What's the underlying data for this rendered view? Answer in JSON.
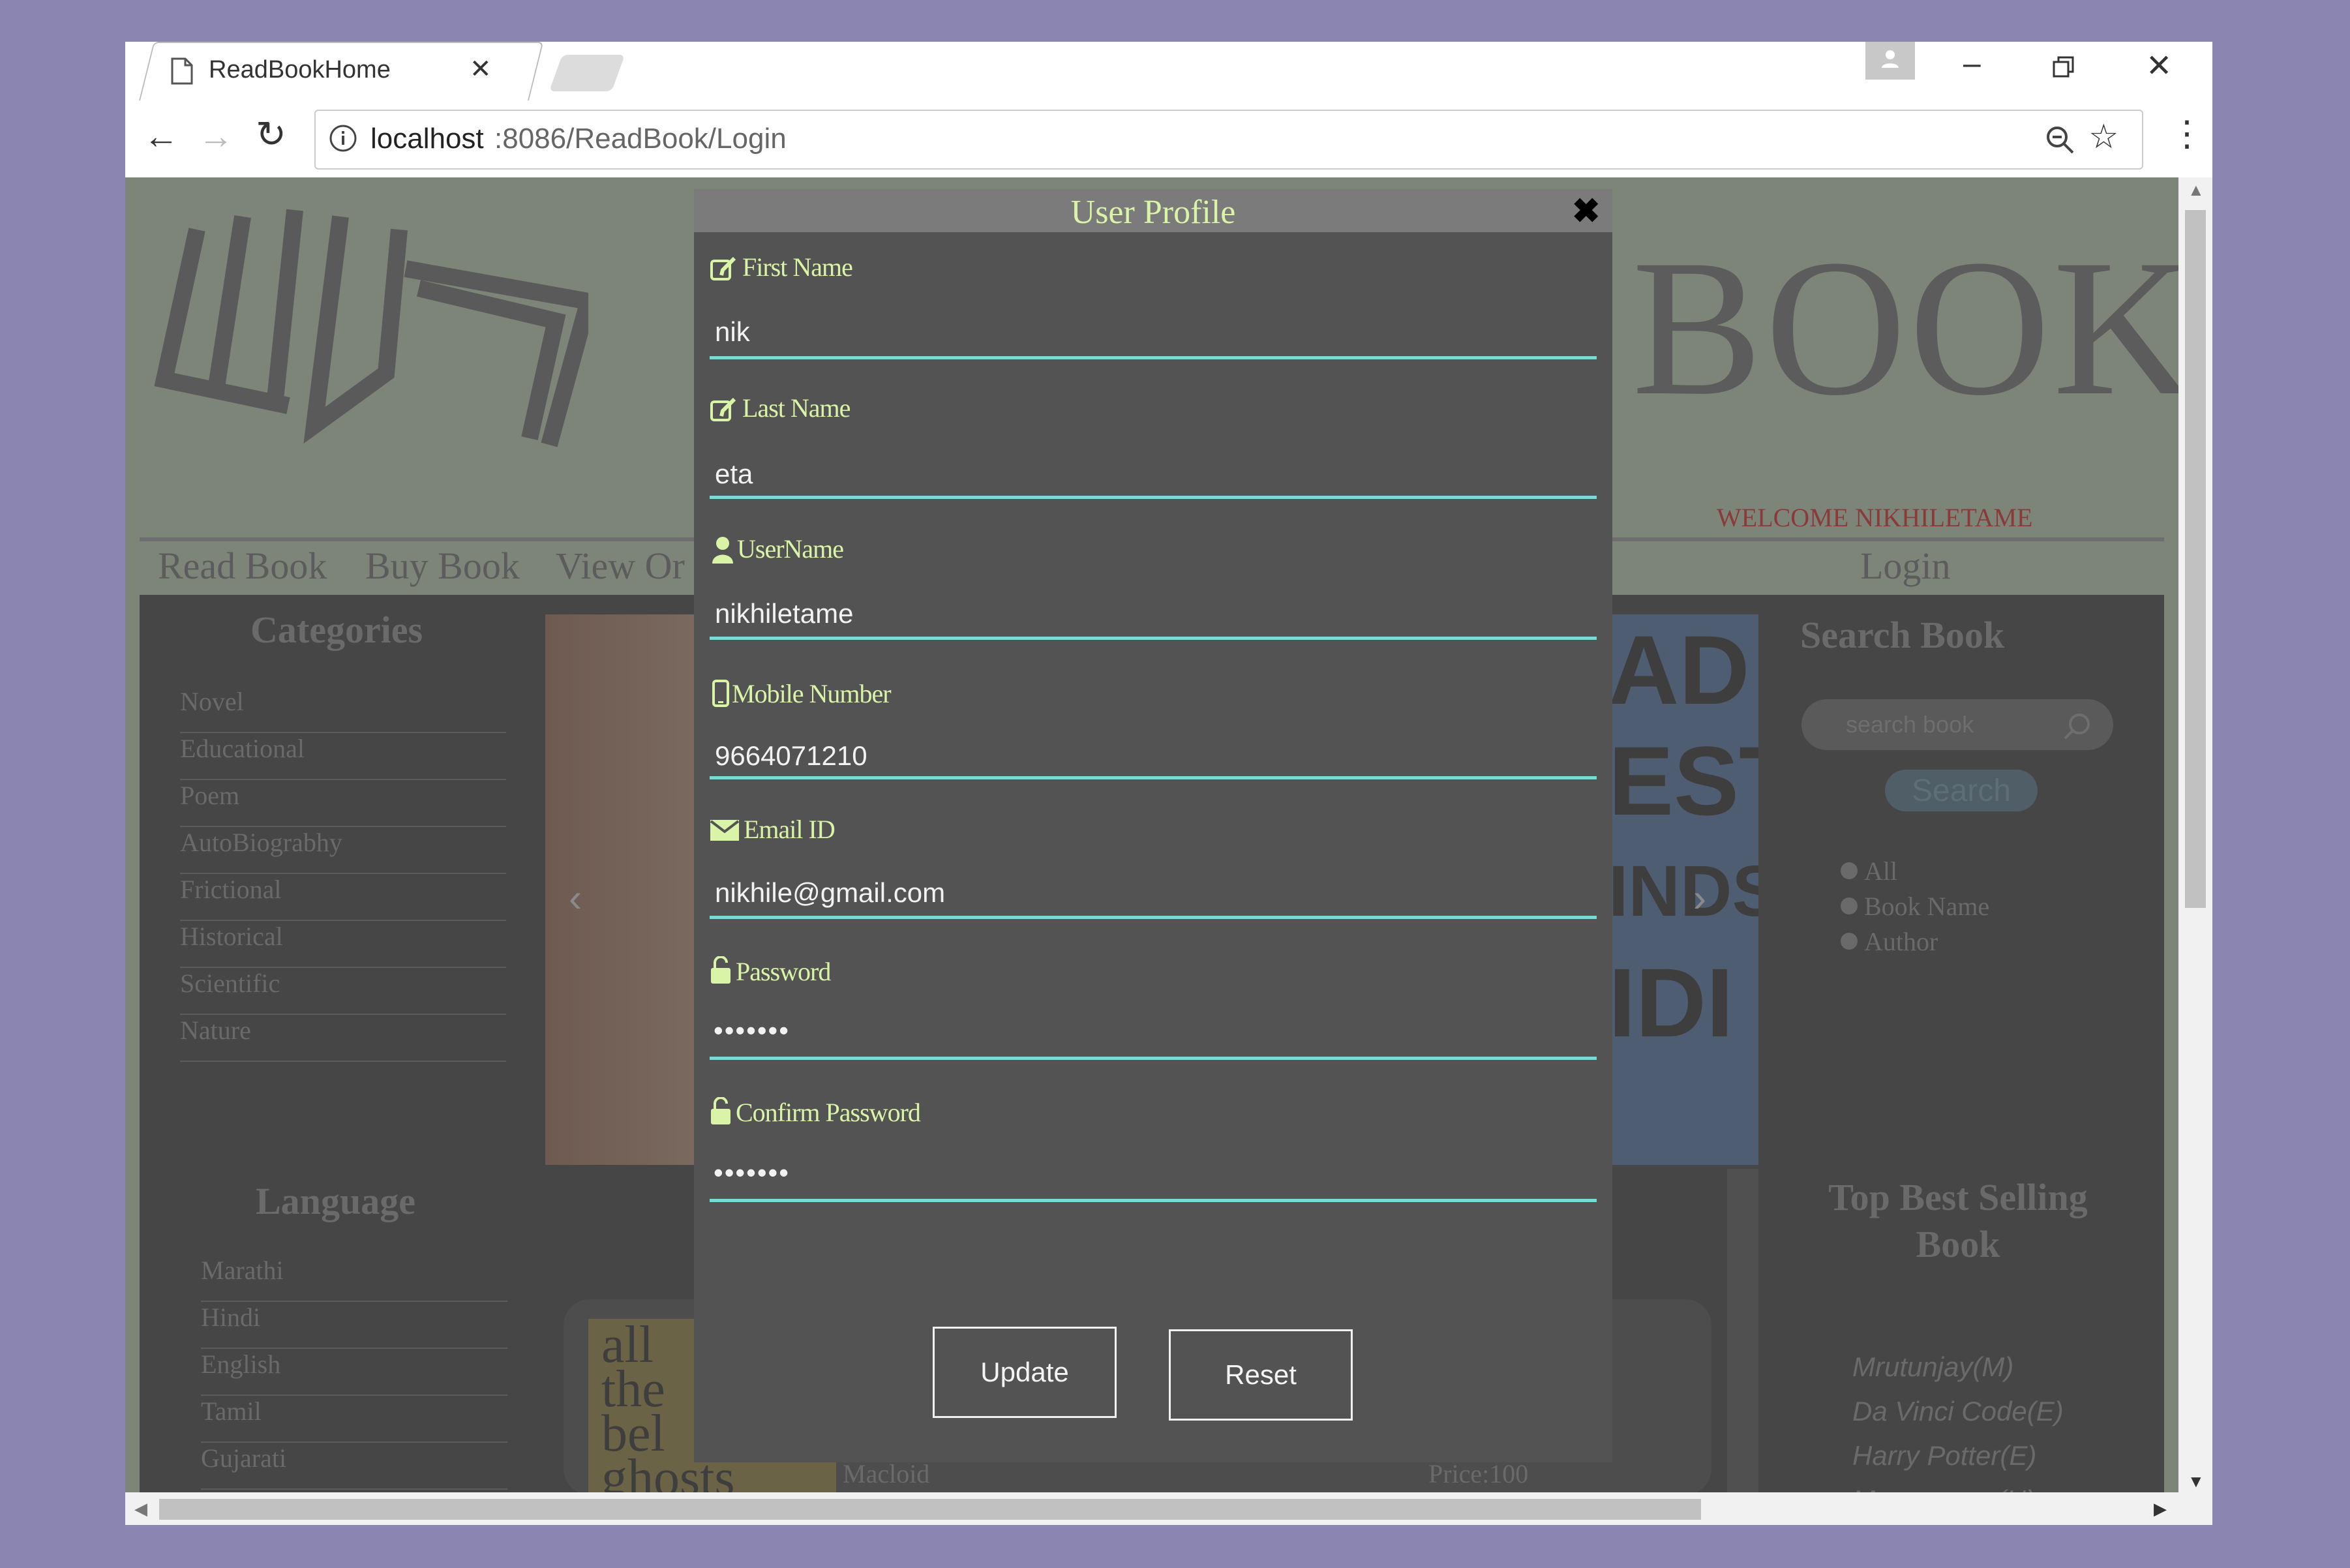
{
  "browser": {
    "tab_title": "ReadBookHome",
    "url_host": "localhost",
    "url_rest": ":8086/ReadBook/Login"
  },
  "background": {
    "nav": [
      "Read Book",
      "Buy Book",
      "View Or"
    ],
    "logo_text": "BOOK",
    "welcome": "WELCOME NIKHILETAME",
    "login": "Login",
    "categories_title": "Categories",
    "categories": [
      "Novel",
      "Educational",
      "Poem",
      "AutoBiograbhy",
      "Frictional",
      "Historical",
      "Scientific",
      "Nature"
    ],
    "language_title": "Language",
    "languages": [
      "Marathi",
      "Hindi",
      "English",
      "Tamil",
      "Gujarati"
    ],
    "search_title": "Search Book",
    "search_placeholder": "search book",
    "search_button": "Search",
    "search_options": [
      "All",
      "Book Name",
      "Author"
    ],
    "top_title_1": "Top Best Selling",
    "top_title_2": "Book",
    "top_books": [
      "Mrutunjay(M)",
      "Da Vinci Code(E)",
      "Harry Potter(E)",
      "Mansarovar(H)"
    ],
    "banner_text": [
      "AD",
      "EST",
      "INDS",
      "IDI"
    ],
    "book_snippet": [
      "all",
      "the",
      "bel",
      "ghosts"
    ],
    "macloid": "Macloid",
    "price": "Price:100"
  },
  "modal": {
    "title": "User Profile",
    "fields": [
      {
        "label": "First Name",
        "value": "nik",
        "icon": "edit-icon"
      },
      {
        "label": "Last Name",
        "value": "eta",
        "icon": "edit-icon"
      },
      {
        "label": "UserName",
        "value": "nikhiletame",
        "icon": "user-icon"
      },
      {
        "label": "Mobile Number",
        "value": "9664071210",
        "icon": "mobile-icon"
      },
      {
        "label": "Email ID",
        "value": "nikhile@gmail.com",
        "icon": "envelope-icon"
      },
      {
        "label": "Password",
        "value": "•••••••",
        "icon": "unlock-icon"
      },
      {
        "label": "Confirm Password",
        "value": "•••••••",
        "icon": "unlock-icon"
      }
    ],
    "update_label": "Update",
    "reset_label": "Reset"
  },
  "colors": {
    "label": "#d9f4a6",
    "underline": "#7fd8d8",
    "welcome": "#8b3a3a"
  }
}
